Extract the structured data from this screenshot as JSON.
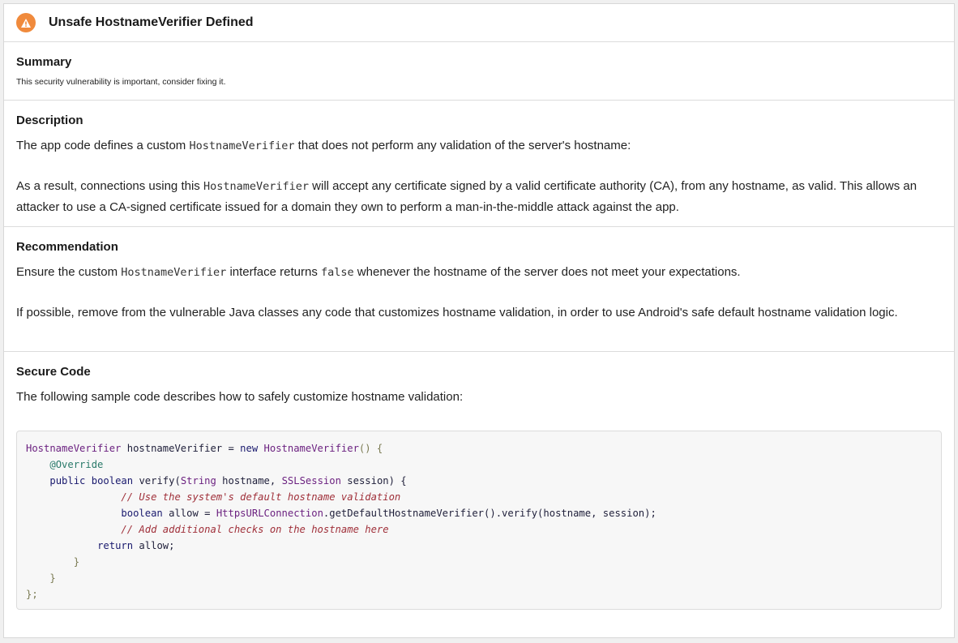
{
  "header": {
    "title": "Unsafe HostnameVerifier Defined",
    "icon": "warning-icon",
    "icon_color": "#f08a3c"
  },
  "summary": {
    "heading": "Summary",
    "text": "This security vulnerability is important, consider fixing it."
  },
  "description": {
    "heading": "Description",
    "p1_before": "The app code defines a custom ",
    "p1_code": "HostnameVerifier",
    "p1_after": " that does not perform any validation of the server's hostname:",
    "p2_before": "As a result, connections using this ",
    "p2_code": "HostnameVerifier",
    "p2_after": " will accept any certificate signed by a valid certificate authority (CA), from any hostname, as valid. This allows an attacker to use a CA-signed certificate issued for a domain they own to perform a man-in-the-middle attack against the app."
  },
  "recommendation": {
    "heading": "Recommendation",
    "p1_before": "Ensure the custom ",
    "p1_code": "HostnameVerifier",
    "p1_mid": " interface returns ",
    "p1_code2": "false",
    "p1_after": " whenever the hostname of the server does not meet your expectations.",
    "p2": "If possible, remove from the vulnerable Java classes any code that customizes hostname validation, in order to use Android's safe default hostname validation logic."
  },
  "secure_code": {
    "heading": "Secure Code",
    "intro": "The following sample code describes how to safely customize hostname validation:",
    "lines": {
      "l1": {
        "t1": "HostnameVerifier",
        "t2": " hostnameVerifier = ",
        "t3": "new",
        "t4": " ",
        "t5": "HostnameVerifier",
        "t6": "() {"
      },
      "l2": {
        "indent": "    ",
        "t1": "@Override"
      },
      "l3": {
        "indent": "    ",
        "t1": "public",
        "t2": " ",
        "t3": "boolean",
        "t4": " verify(",
        "t5": "String",
        "t6": " hostname, ",
        "t7": "SSLSession",
        "t8": " session) {"
      },
      "l4": {
        "indent": "                ",
        "t1": "// Use the system's default hostname validation"
      },
      "l5": {
        "indent": "                ",
        "t1": "boolean",
        "t2": " allow = ",
        "t3": "HttpsURLConnection",
        "t4": ".getDefaultHostnameVerifier().verify(hostname, session);"
      },
      "l6": {
        "indent": "                ",
        "t1": "// Add additional checks on the hostname here"
      },
      "l7": {
        "indent": "            ",
        "t1": "return",
        "t2": " allow;"
      },
      "l8": {
        "indent": "        ",
        "t1": "}"
      },
      "l9": {
        "indent": "    ",
        "t1": "}"
      },
      "l10": {
        "t1": "};"
      }
    }
  }
}
